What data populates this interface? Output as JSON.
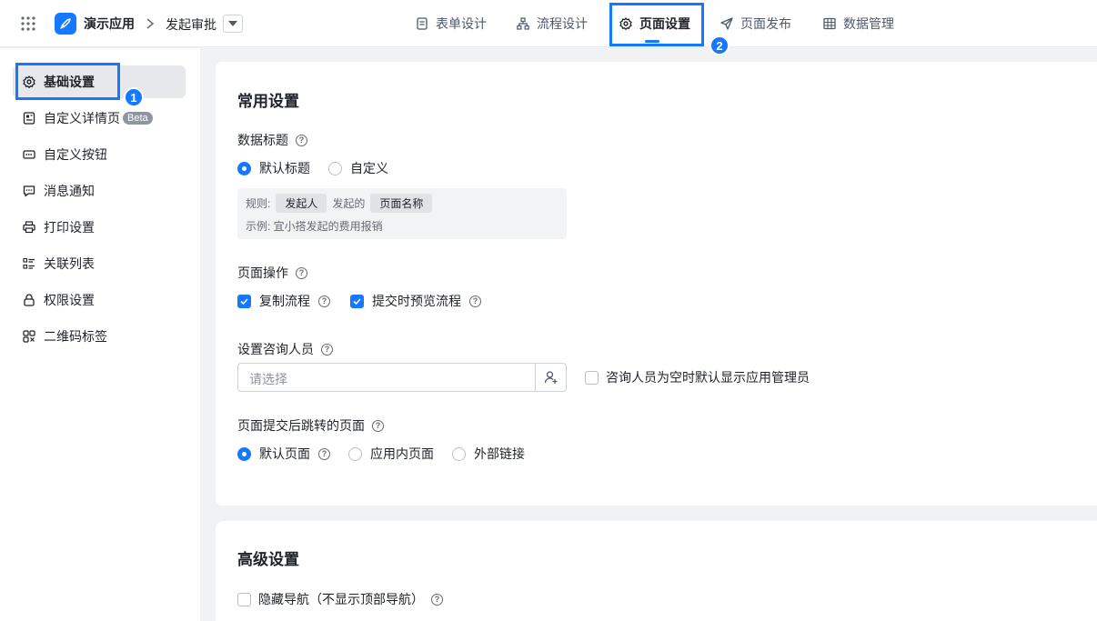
{
  "header": {
    "app_name": "演示应用",
    "form_name": "发起审批",
    "tabs": [
      {
        "label": "表单设计",
        "icon": "form-icon"
      },
      {
        "label": "流程设计",
        "icon": "flow-icon"
      },
      {
        "label": "页面设置",
        "icon": "gear-icon",
        "active": true
      },
      {
        "label": "页面发布",
        "icon": "send-icon"
      },
      {
        "label": "数据管理",
        "icon": "table-icon"
      }
    ]
  },
  "callouts": {
    "one": "1",
    "two": "2"
  },
  "sidebar": {
    "items": [
      {
        "label": "基础设置",
        "icon": "gear-icon",
        "active": true
      },
      {
        "label": "自定义详情页",
        "icon": "detail-page-icon",
        "badge": "Beta"
      },
      {
        "label": "自定义按钮",
        "icon": "btn-icon"
      },
      {
        "label": "消息通知",
        "icon": "message-icon"
      },
      {
        "label": "打印设置",
        "icon": "printer-icon"
      },
      {
        "label": "关联列表",
        "icon": "list-icon"
      },
      {
        "label": "权限设置",
        "icon": "lock-icon"
      },
      {
        "label": "二维码标签",
        "icon": "qrcode-icon"
      }
    ]
  },
  "common": {
    "title": "常用设置",
    "data_title": {
      "label": "数据标题",
      "options": [
        {
          "label": "默认标题",
          "checked": true
        },
        {
          "label": "自定义",
          "checked": false
        }
      ],
      "rule_label": "规则:",
      "rule_chip1": "发起人",
      "rule_mid": "发起的",
      "rule_chip2": "页面名称",
      "example": "示例: 宜小搭发起的费用报销"
    },
    "page_ops": {
      "label": "页面操作",
      "options": [
        {
          "label": "复制流程",
          "checked": true
        },
        {
          "label": "提交时预览流程",
          "checked": true
        }
      ]
    },
    "consultant": {
      "label": "设置咨询人员",
      "placeholder": "请选择",
      "checkbox_label": "咨询人员为空时默认显示应用管理员"
    },
    "redirect": {
      "label": "页面提交后跳转的页面",
      "options": [
        {
          "label": "默认页面",
          "checked": true
        },
        {
          "label": "应用内页面",
          "checked": false
        },
        {
          "label": "外部链接",
          "checked": false
        }
      ]
    }
  },
  "advanced": {
    "title": "高级设置",
    "hide_nav_label": "隐藏导航（不显示顶部导航）"
  },
  "colors": {
    "accent": "#1677ff"
  }
}
